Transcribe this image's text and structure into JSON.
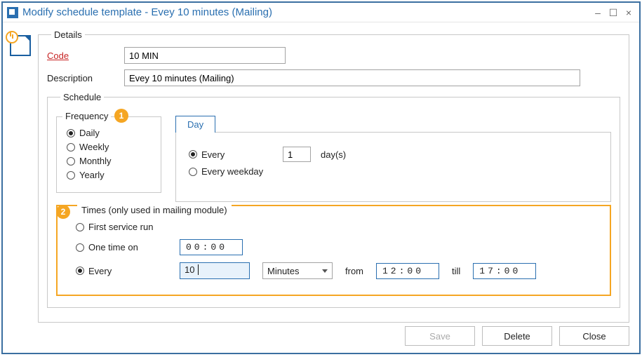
{
  "window": {
    "title": "Modify schedule template - Evey 10 minutes (Mailing)"
  },
  "details": {
    "legend": "Details",
    "codeLabel": "Code",
    "codeValue": "10 MIN",
    "descLabel": "Description",
    "descValue": "Evey 10 minutes (Mailing)"
  },
  "schedule": {
    "legend": "Schedule",
    "frequency": {
      "legend": "Frequency",
      "options": [
        "Daily",
        "Weekly",
        "Monthly",
        "Yearly"
      ],
      "selected": "Daily"
    },
    "day": {
      "tabLabel": "Day",
      "everyLabel": "Every",
      "everyValue": "1",
      "unit": "day(s)",
      "weekdayLabel": "Every weekday",
      "selected": "Every"
    }
  },
  "times": {
    "legend": "Times (only used in mailing module)",
    "options": {
      "firstRun": "First service run",
      "oneTime": "One time on",
      "every": "Every"
    },
    "selected": "Every",
    "oneTimeValue": "00:00",
    "everyValue": "10",
    "everyUnit": "Minutes",
    "fromLabel": "from",
    "fromValue": "12:00",
    "tillLabel": "till",
    "tillValue": "17:00"
  },
  "footer": {
    "save": "Save",
    "delete": "Delete",
    "close": "Close"
  },
  "annotations": {
    "badge1": "1",
    "badge2": "2"
  }
}
